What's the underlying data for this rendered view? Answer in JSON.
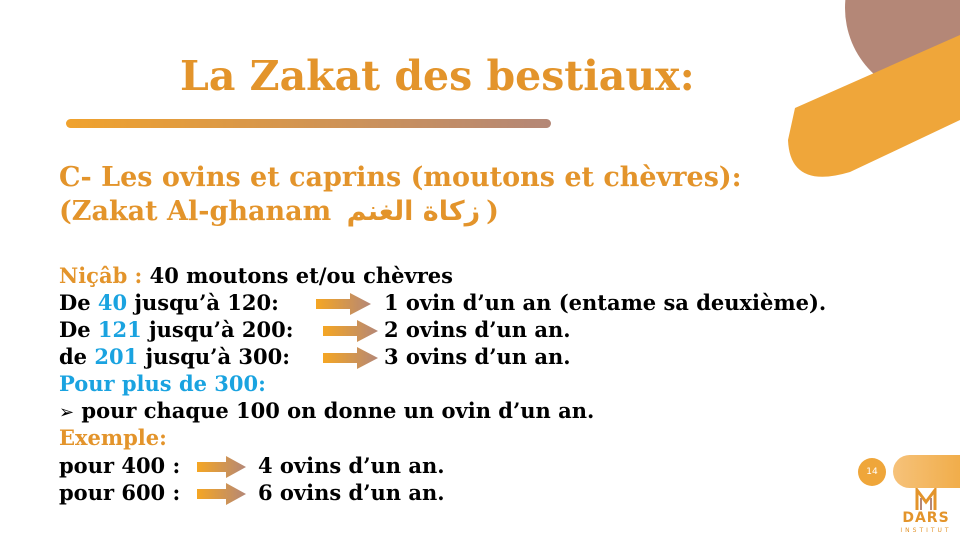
{
  "slide": {
    "title": "La Zakat des bestiaux:",
    "heading_line1": "C- Les ovins et caprins (moutons et chèvres):",
    "heading_line2_prefix": "(Zakat Al-ghanam ",
    "heading_line2_arabic": "زكاة الغنم",
    "heading_line2_suffix": ")",
    "nisab_label": "Niçâb : ",
    "nisab_value": "40 moutons et/ou chèvres",
    "brackets": [
      {
        "prefix": "De ",
        "from": "40",
        "range_rest": " jusqu’à 120:",
        "result": "1 ovin d’un an (entame sa deuxième)."
      },
      {
        "prefix": "De ",
        "from": "121",
        "range_rest": " jusqu’à 200:",
        "result": "2 ovins d’un an."
      },
      {
        "prefix": "de ",
        "from": "201",
        "range_rest": " jusqu’à 300:",
        "result": "3 ovins d’un an."
      }
    ],
    "beyond_label": "Pour plus de 300:",
    "beyond_bullet": "➢",
    "beyond_rule": " pour chaque 100 on donne un ovin d’un an.",
    "example_label": "Exemple:",
    "examples": [
      {
        "count": "pour 400 :",
        "result": "4 ovins d’un an."
      },
      {
        "count": "pour 600 :",
        "result": "6 ovins d’un an."
      }
    ],
    "page_number": "14"
  },
  "logo": {
    "name": "DARS",
    "subtitle": "INSTITUT"
  },
  "colors": {
    "orange": "#e3942b",
    "blue": "#1aa3e0",
    "brown": "#b48777",
    "arrow_orange": "#f0a22d"
  }
}
